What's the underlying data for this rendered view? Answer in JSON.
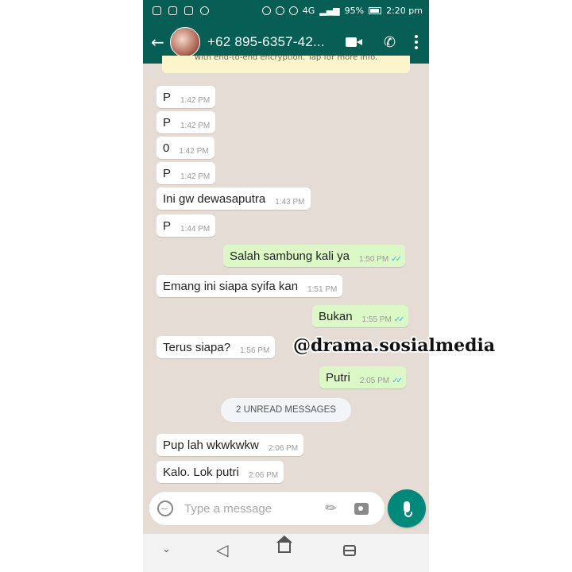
{
  "status_bar": {
    "network": "4G",
    "battery": "95%",
    "time": "2:20 pm"
  },
  "header": {
    "contact_name": "+62 895-6357-42..."
  },
  "encryption_banner": "with end-to-end encryption. Tap for more info.",
  "messages": [
    {
      "text": "P",
      "time": "1:42 PM",
      "direction": "in"
    },
    {
      "text": "P",
      "time": "1:42 PM",
      "direction": "in"
    },
    {
      "text": "0",
      "time": "1:42 PM",
      "direction": "in"
    },
    {
      "text": "P",
      "time": "1:42 PM",
      "direction": "in"
    },
    {
      "text": "Ini gw dewasaputra",
      "time": "1:43 PM",
      "direction": "in"
    },
    {
      "text": "P",
      "time": "1:44 PM",
      "direction": "in"
    },
    {
      "text": "Salah sambung kali ya",
      "time": "1:50 PM",
      "direction": "out",
      "status": "read"
    },
    {
      "text": "Emang ini siapa syifa kan",
      "time": "1:51 PM",
      "direction": "in"
    },
    {
      "text": "Bukan",
      "time": "1:55 PM",
      "direction": "out",
      "status": "read"
    },
    {
      "text": "Terus siapa?",
      "time": "1:56 PM",
      "direction": "in"
    },
    {
      "text": "Putri",
      "time": "2:05 PM",
      "direction": "out",
      "status": "read"
    },
    {
      "text": "Pup lah wkwkwkw",
      "time": "2:06 PM",
      "direction": "in"
    },
    {
      "text": "Kalo. Lok putri",
      "time": "2:06 PM",
      "direction": "in"
    }
  ],
  "unread_divider": "2 UNREAD MESSAGES",
  "composer": {
    "placeholder": "Type a message"
  },
  "watermark": "@drama.sosialmedia",
  "colors": {
    "header": "#075e54",
    "incoming": "#ffffff",
    "outgoing": "#dcf8c6",
    "chat_bg": "#e5ddd5",
    "read_tick": "#34b7f1",
    "mic_button": "#00897b"
  }
}
